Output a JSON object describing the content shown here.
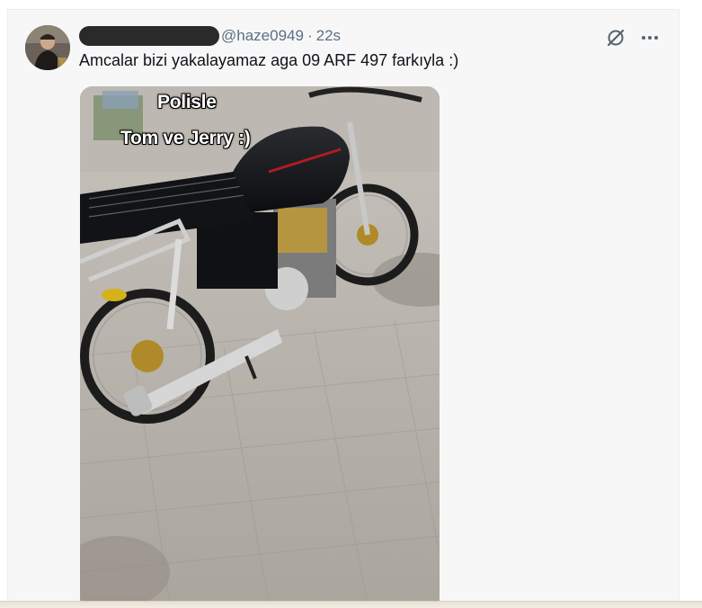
{
  "tweet": {
    "handle": "@haze0949",
    "separator": "·",
    "time": "22s",
    "text": "Amcalar bizi yakalayamaz aga 09 ARF 497 farkıyla :)"
  },
  "media": {
    "overlay_line1": "Polisle",
    "overlay_line2": "Tom ve Jerry :)"
  },
  "icons": {
    "grok": "grok-icon",
    "more": "more-icon"
  },
  "colors": {
    "text": "#0f1419",
    "muted": "#5b7083"
  }
}
